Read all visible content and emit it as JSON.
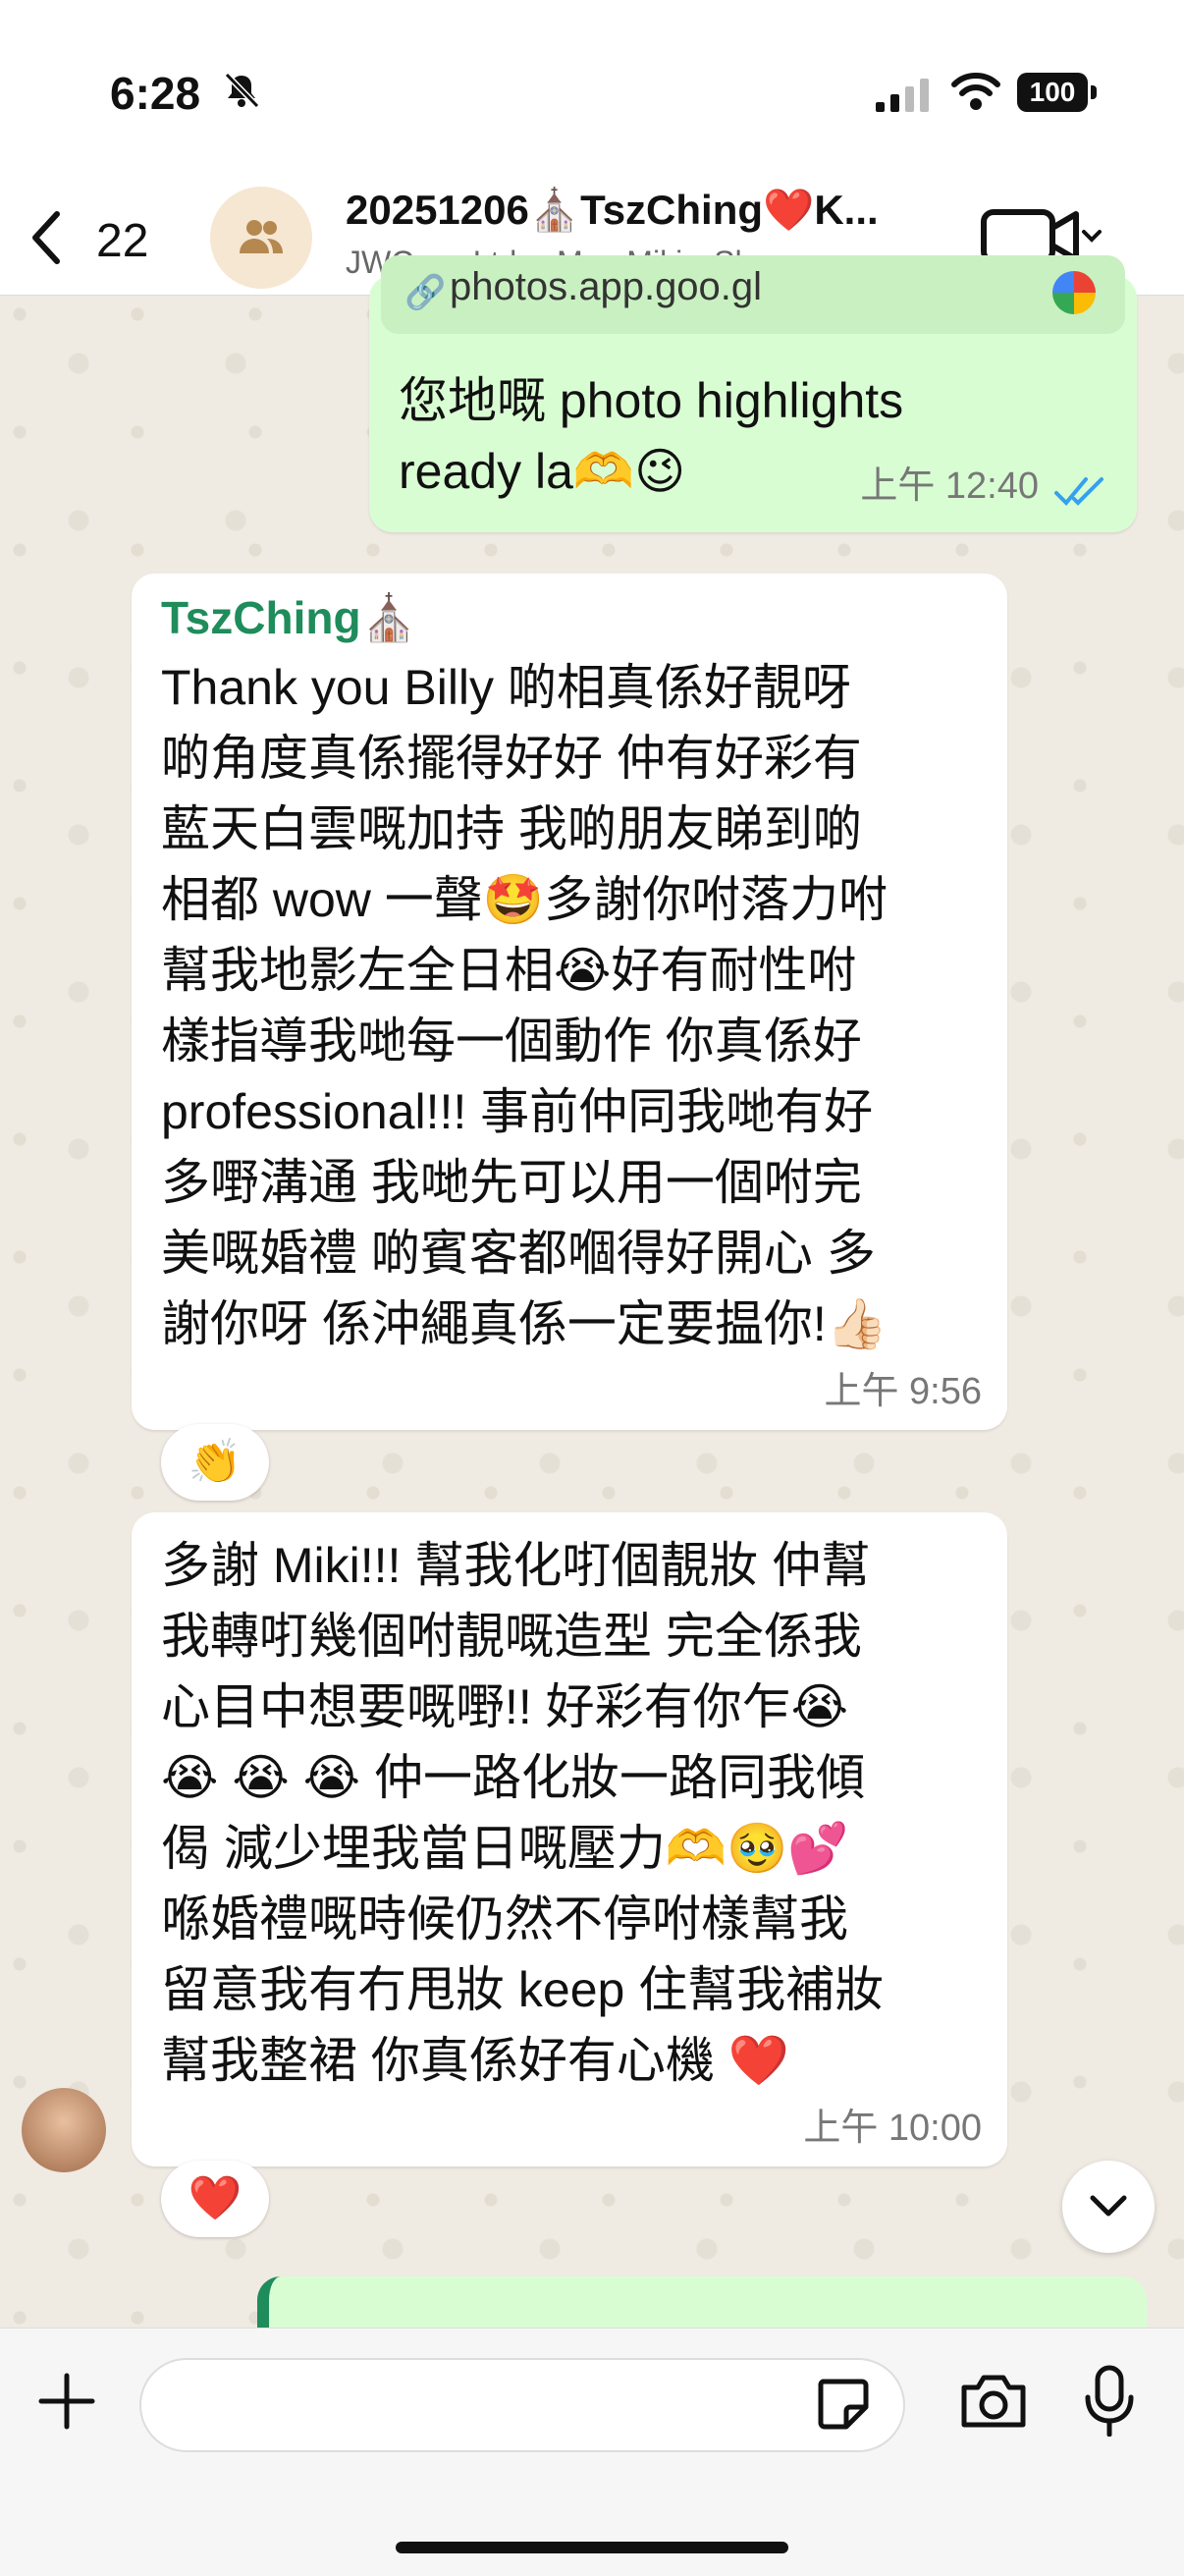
{
  "status_bar": {
    "time": "6:28",
    "battery": "100"
  },
  "header": {
    "back_count": "22",
    "title": "20251206⛪️TszChing❤️K...",
    "subtitle": "JWC co. Ltd.、Mua Miki、Sharon..."
  },
  "messages": [
    {
      "type": "outgoing",
      "link": "photos.app.goo.gl",
      "lines": [
        "您地嘅 photo highlights",
        "ready la🫶😉"
      ],
      "time": "上午 12:40"
    },
    {
      "type": "incoming",
      "sender": "TszChing⛪️",
      "lines": [
        "Thank you Billy 啲相真係好靚呀",
        "啲角度真係擺得好好 仲有好彩有",
        "藍天白雲嘅加持 我啲朋友睇到啲",
        "相都 wow 一聲🤩多謝你咐落力咐",
        "幫我地影左全日相😭好有耐性咐",
        "樣指導我哋每一個動作 你真係好",
        " professional!!! 事前仲同我哋有好",
        "多嘢溝通 我哋先可以用一個咐完",
        "美嘅婚禮 啲賓客都嗰得好開心 多",
        "謝你呀 係沖繩真係一定要揾你!👍🏻"
      ],
      "time": "上午 9:56",
      "reaction": "👏"
    },
    {
      "type": "incoming",
      "lines": [
        "多謝 Miki!!! 幫我化咑個靚妝 仲幫",
        "我轉咑幾個咐靚嘅造型 完全係我",
        "心目中想要嘅嘢!! 好彩有你乍😭",
        "😭 😭 😭 仲一路化妝一路同我傾",
        "偈 減少埋我當日嘅壓力🫶🥹💕",
        "喺婚禮嘅時候仍然不停咐樣幫我",
        "留意我有冇甩妝 keep 住幫我補妝",
        "幫我整裙 你真係好有心機 ❤️"
      ],
      "time": "上午 10:00",
      "reaction": "❤️"
    }
  ],
  "colors": {
    "outgoing_bubble": "#d9fdd3",
    "incoming_bubble": "#ffffff",
    "sender_name": "#1f8c5b",
    "read_ticks": "#34a0f0"
  }
}
